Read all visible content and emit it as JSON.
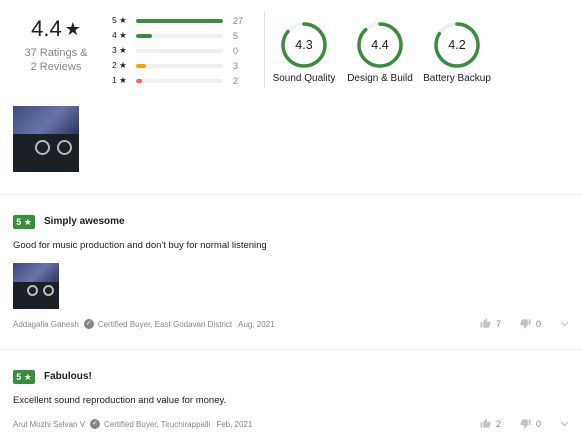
{
  "summary": {
    "average": "4.4",
    "star_glyph": "★",
    "ratings_text": "37 Ratings &",
    "reviews_text": "2 Reviews",
    "histogram": [
      {
        "label": "5 ★",
        "count": "27",
        "fraction": 1.0,
        "color": "#388e3c"
      },
      {
        "label": "4 ★",
        "count": "5",
        "fraction": 0.185,
        "color": "#388e3c"
      },
      {
        "label": "3 ★",
        "count": "0",
        "fraction": 0.0,
        "color": "#388e3c"
      },
      {
        "label": "2 ★",
        "count": "3",
        "fraction": 0.111,
        "color": "#ff9f00"
      },
      {
        "label": "1 ★",
        "count": "2",
        "fraction": 0.074,
        "color": "#ff6161"
      }
    ]
  },
  "features": [
    {
      "name": "Sound Quality",
      "value": "4.3",
      "fraction": 0.86
    },
    {
      "name": "Design & Build",
      "value": "4.4",
      "fraction": 0.88
    },
    {
      "name": "Battery Backup",
      "value": "4.2",
      "fraction": 0.84
    }
  ],
  "colors": {
    "green": "#388e3c",
    "ring_track": "#f0f0f0",
    "muted": "#878787"
  },
  "reviews": [
    {
      "rating": "5 ★",
      "title": "Simply awesome",
      "body": "Good for music production and don't buy for normal listening",
      "author": "Addagalla Ganesh",
      "certified": "Certified Buyer, East Godavari District",
      "date": "Aug, 2021",
      "likes": "7",
      "dislikes": "0"
    },
    {
      "rating": "5 ★",
      "title": "Fabulous!",
      "body": "Excellent sound reproduction and value for money.",
      "author": "Arul Mozhi Selvan V",
      "certified": "Certified Buyer, Tiruchirappalli",
      "date": "Feb, 2021",
      "likes": "2",
      "dislikes": "0"
    }
  ],
  "icons": {
    "check": "✓",
    "like": "thumbs-up-icon",
    "dislike": "thumbs-down-icon",
    "expand": "chevron-down-icon"
  }
}
